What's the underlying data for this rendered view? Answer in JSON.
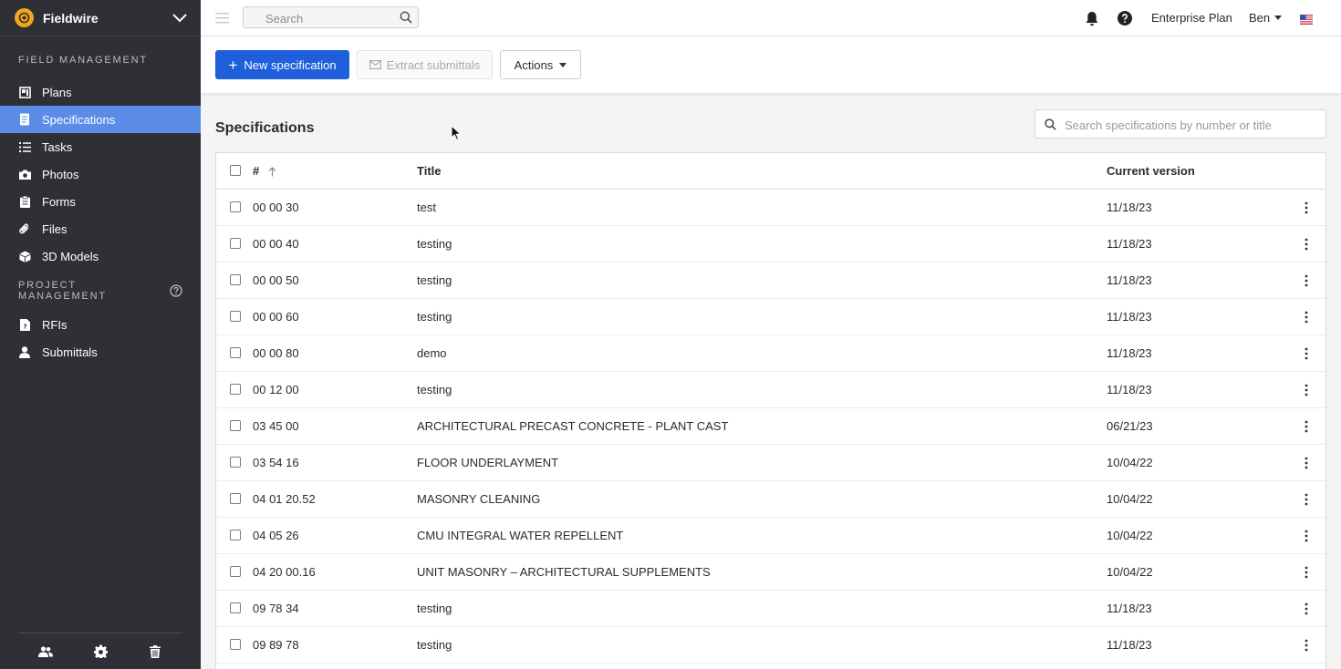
{
  "app": {
    "name": "Fieldwire",
    "brand_color": "#f2a71b",
    "accent_color": "#1f5fdb",
    "sidebar_active_color": "#5b8ce6"
  },
  "sidebar": {
    "field_management_title": "FIELD MANAGEMENT",
    "field_items": [
      {
        "label": "Plans",
        "icon": "plans-icon"
      },
      {
        "label": "Specifications",
        "icon": "specifications-icon",
        "active": true
      },
      {
        "label": "Tasks",
        "icon": "tasks-icon"
      },
      {
        "label": "Photos",
        "icon": "camera-icon"
      },
      {
        "label": "Forms",
        "icon": "forms-icon"
      },
      {
        "label": "Files",
        "icon": "paperclip-icon"
      },
      {
        "label": "3D Models",
        "icon": "cube-icon"
      }
    ],
    "project_management_title": "PROJECT MANAGEMENT",
    "project_items": [
      {
        "label": "RFIs",
        "icon": "rfi-icon"
      },
      {
        "label": "Submittals",
        "icon": "submittals-icon"
      }
    ],
    "footer_icons": [
      "people-icon",
      "gear-icon",
      "trash-icon"
    ]
  },
  "topbar": {
    "search_placeholder": "Search",
    "plan": "Enterprise Plan",
    "user": "Ben"
  },
  "toolbar": {
    "new_label": "New specification",
    "extract_label": "Extract submittals",
    "actions_label": "Actions"
  },
  "main": {
    "title": "Specifications",
    "search_placeholder": "Search specifications by number or title"
  },
  "table": {
    "headers": {
      "number": "#",
      "title": "Title",
      "version": "Current version"
    },
    "rows": [
      {
        "number": "00 00 30",
        "title": "test",
        "version": "11/18/23"
      },
      {
        "number": "00 00 40",
        "title": "testing",
        "version": "11/18/23"
      },
      {
        "number": "00 00 50",
        "title": "testing",
        "version": "11/18/23"
      },
      {
        "number": "00 00 60",
        "title": "testing",
        "version": "11/18/23"
      },
      {
        "number": "00 00 80",
        "title": "demo",
        "version": "11/18/23"
      },
      {
        "number": "00 12 00",
        "title": "testing",
        "version": "11/18/23"
      },
      {
        "number": "03 45 00",
        "title": "ARCHITECTURAL PRECAST CONCRETE - PLANT CAST",
        "version": "06/21/23"
      },
      {
        "number": "03 54 16",
        "title": "FLOOR UNDERLAYMENT",
        "version": "10/04/22"
      },
      {
        "number": "04 01 20.52",
        "title": "MASONRY CLEANING",
        "version": "10/04/22"
      },
      {
        "number": "04 05 26",
        "title": "CMU INTEGRAL WATER REPELLENT",
        "version": "10/04/22"
      },
      {
        "number": "04 20 00.16",
        "title": "UNIT MASONRY – ARCHITECTURAL SUPPLEMENTS",
        "version": "10/04/22"
      },
      {
        "number": "09 78 34",
        "title": "testing",
        "version": "11/18/23"
      },
      {
        "number": "09 89 78",
        "title": "testing",
        "version": "11/18/23"
      }
    ]
  }
}
